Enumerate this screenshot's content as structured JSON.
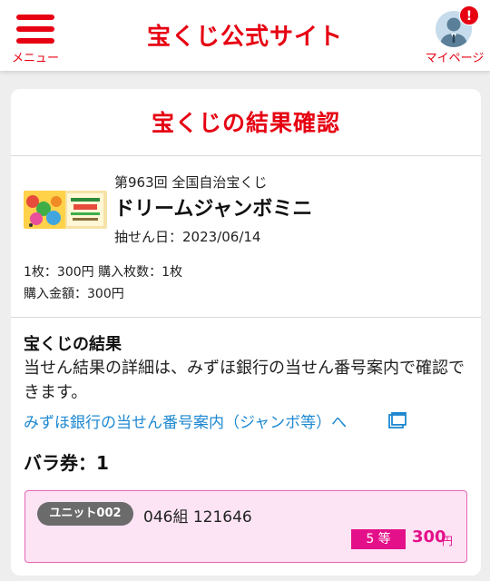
{
  "header": {
    "menu_label": "メニュー",
    "site_title": "宝くじ公式サイト",
    "mypage_label": "マイページ",
    "notification_badge": "!",
    "accent_color": "#e60012"
  },
  "card": {
    "title": "宝くじの結果確認",
    "lottery": {
      "draw_number": "第963回 全国自治宝くじ",
      "name": "ドリームジャンボミニ",
      "draw_date": "抽せん日：2023/06/14",
      "price_info": "1枚：300円 購入枚数：1枚",
      "total": "購入金額：300円"
    },
    "result": {
      "heading": "宝くじの結果",
      "description": "当せん結果の詳細は、みずほ銀行の当せん番号案内で確認できます。",
      "link_label": "みずほ銀行の当せん番号案内（ジャンボ等）へ",
      "link_icon": "external-link-icon",
      "link_color": "#1e88d0"
    },
    "bara": {
      "label": "バラ券：1"
    },
    "units": [
      {
        "badge": "ユニット002",
        "number": "046組 121646",
        "rank": "5 等",
        "amount": "300",
        "amount_unit": "円",
        "highlight_color": "#e4108a"
      }
    ]
  }
}
